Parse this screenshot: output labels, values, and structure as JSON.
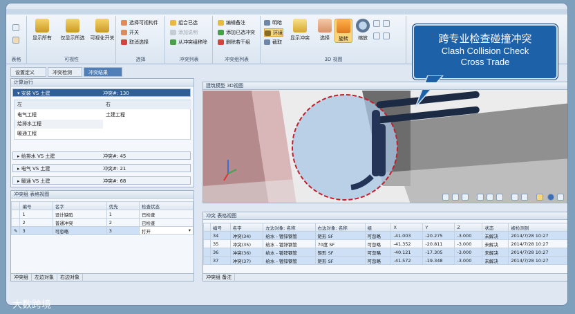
{
  "ribbon": {
    "groups": [
      {
        "label": "表格"
      },
      {
        "label": "可视性",
        "buttons": [
          "显示所有",
          "仅显示所选",
          "可视化开关"
        ]
      },
      {
        "label": "选择",
        "items": [
          "选择可视构件",
          "开关",
          "取消选择"
        ]
      },
      {
        "label": "冲突列表",
        "items": [
          "组合已选",
          "添加说明",
          "从冲突组移除"
        ]
      },
      {
        "label": "冲突组列表",
        "items": [
          "编辑备注",
          "添加已选冲突",
          "删除若干组"
        ]
      },
      {
        "label": "3D 视图",
        "items": [
          "明暗",
          "环境",
          "截取"
        ],
        "buttons": [
          "显示冲突",
          "选择",
          "旋转",
          "缩放"
        ]
      }
    ]
  },
  "breadcrumb": [
    "设置定义",
    "冲突检测",
    "冲突结果"
  ],
  "left_panel": {
    "title": "计算运行",
    "selected_test": {
      "name": "安装 VS 土建",
      "count": "冲突#: 130"
    },
    "columns": [
      "左",
      "右"
    ],
    "left_items": [
      "电气工程",
      "给排水工程",
      "暖通工程"
    ],
    "right_items": [
      "土建工程"
    ],
    "tests": [
      {
        "name": "给排水 VS 土建",
        "count": "冲突#: 45"
      },
      {
        "name": "电气 VS 土建",
        "count": "冲突#: 21"
      },
      {
        "name": "暖通 VS 土建",
        "count": "冲突#: 68"
      }
    ]
  },
  "group_panel": {
    "title": "冲突组  表格视图",
    "headers": [
      "编号",
      "名字",
      "优先",
      "检查状态"
    ],
    "rows": [
      {
        "id": "1",
        "name": "设计缺陷",
        "priority": "1",
        "status": "已检查"
      },
      {
        "id": "2",
        "name": "普通冲突",
        "priority": "2",
        "status": "已检查"
      },
      {
        "id": "3",
        "name": "可忽略",
        "priority": "3",
        "status": "打开"
      }
    ],
    "tabs": [
      "冲突组",
      "左边对象",
      "右边对象"
    ]
  },
  "view3d": {
    "title": "建筑模型  3D视图"
  },
  "callout": {
    "cn": "跨专业检查碰撞冲突",
    "en_line1": "Clash Collision Check",
    "en_line2": "Cross Trade"
  },
  "clash_panel": {
    "title": "冲突  表格视图",
    "headers": [
      "编号",
      "名字",
      "左边对象: 名称",
      "右边对象: 名称",
      "组",
      "X",
      "Y",
      "Z",
      "状态",
      "被检测到"
    ],
    "rows": [
      {
        "id": "34",
        "name": "冲突(34)",
        "left": "给水 - 镀锌钢管",
        "right": "矩形 SF",
        "group": "可忽略",
        "x": "-41.003",
        "y": "-20.275",
        "z": "-3.000",
        "status": "未解决",
        "date": "2014/7/28 10:27"
      },
      {
        "id": "35",
        "name": "冲突(35)",
        "left": "给水 - 镀锌钢管",
        "right": "70度 SF",
        "group": "可忽略",
        "x": "-41.352",
        "y": "-20.811",
        "z": "-3.000",
        "status": "未解决",
        "date": "2014/7/28 10:27"
      },
      {
        "id": "36",
        "name": "冲突(36)",
        "left": "给水 - 镀锌钢管",
        "right": "矩形 SF",
        "group": "可忽略",
        "x": "-40.121",
        "y": "-17.305",
        "z": "-3.000",
        "status": "未解决",
        "date": "2014/7/28 10:27"
      },
      {
        "id": "37",
        "name": "冲突(37)",
        "left": "给水 - 镀锌钢管",
        "right": "矩形 SF",
        "group": "可忽略",
        "x": "-41.572",
        "y": "-19.348",
        "z": "-3.000",
        "status": "未解决",
        "date": "2014/7/28 10:27"
      }
    ],
    "bottom_tab": "冲突组  备注"
  },
  "watermark": "大数跨境",
  "colors": {
    "accent": "#2f5e99",
    "callout": "#1d61a8",
    "highlight": "#cde0f5"
  }
}
